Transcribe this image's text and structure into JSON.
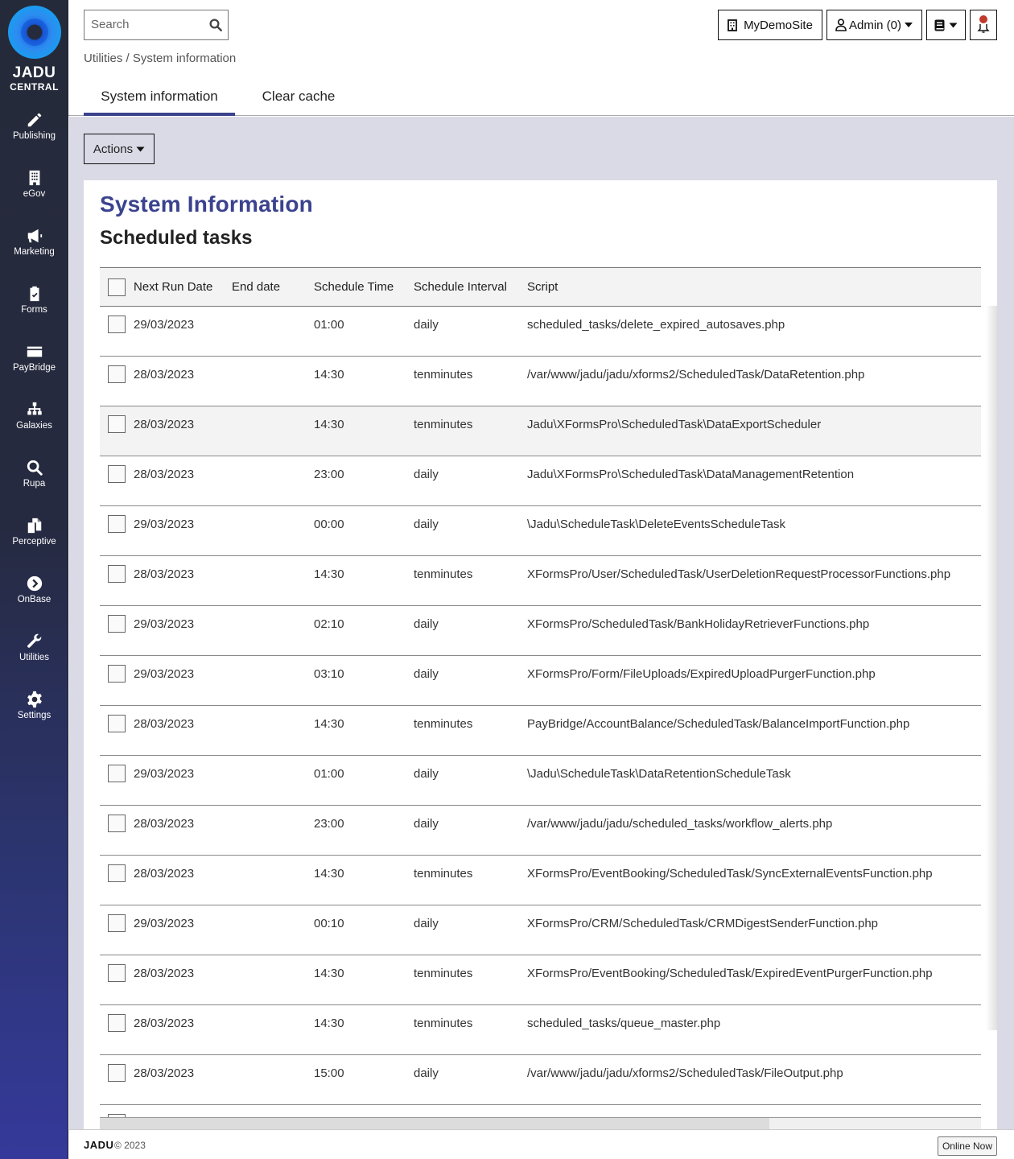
{
  "brand": {
    "name_line1": "JADU",
    "name_line2": "CENTRAL",
    "accent_color": "#3b428e"
  },
  "sidebar": {
    "items": [
      {
        "label": "Publishing",
        "icon": "pencil-icon"
      },
      {
        "label": "eGov",
        "icon": "building-icon"
      },
      {
        "label": "Marketing",
        "icon": "megaphone-icon"
      },
      {
        "label": "Forms",
        "icon": "clipboard-check-icon"
      },
      {
        "label": "PayBridge",
        "icon": "credit-card-icon"
      },
      {
        "label": "Galaxies",
        "icon": "sitemap-icon"
      },
      {
        "label": "Rupa",
        "icon": "search-icon"
      },
      {
        "label": "Perceptive",
        "icon": "copy-icon"
      },
      {
        "label": "OnBase",
        "icon": "chevron-circle-right-icon"
      },
      {
        "label": "Utilities",
        "icon": "wrench-icon"
      },
      {
        "label": "Settings",
        "icon": "gear-icon"
      }
    ]
  },
  "header": {
    "search_placeholder": "Search",
    "site_button": "MyDemoSite",
    "user_button": "Admin (0)",
    "breadcrumb": [
      "Utilities",
      "System information"
    ],
    "breadcrumb_separator": " / "
  },
  "tabs": [
    {
      "label": "System information",
      "active": true
    },
    {
      "label": "Clear cache",
      "active": false
    }
  ],
  "toolbar": {
    "actions_label": "Actions"
  },
  "panel": {
    "title": "System Information",
    "subtitle": "Scheduled tasks"
  },
  "table": {
    "columns": [
      "Next Run Date",
      "End date",
      "Schedule Time",
      "Schedule Interval",
      "Script"
    ],
    "rows": [
      {
        "next_run": "29/03/2023",
        "end_date": "",
        "time": "01:00",
        "interval": "daily",
        "script": "scheduled_tasks/delete_expired_autosaves.php"
      },
      {
        "next_run": "28/03/2023",
        "end_date": "",
        "time": "14:30",
        "interval": "tenminutes",
        "script": "/var/www/jadu/jadu/xforms2/ScheduledTask/DataRetention.php"
      },
      {
        "next_run": "28/03/2023",
        "end_date": "",
        "time": "14:30",
        "interval": "tenminutes",
        "script": "Jadu\\XFormsPro\\ScheduledTask\\DataExportScheduler",
        "highlighted": true
      },
      {
        "next_run": "28/03/2023",
        "end_date": "",
        "time": "23:00",
        "interval": "daily",
        "script": "Jadu\\XFormsPro\\ScheduledTask\\DataManagementRetention"
      },
      {
        "next_run": "29/03/2023",
        "end_date": "",
        "time": "00:00",
        "interval": "daily",
        "script": "\\Jadu\\ScheduleTask\\DeleteEventsScheduleTask"
      },
      {
        "next_run": "28/03/2023",
        "end_date": "",
        "time": "14:30",
        "interval": "tenminutes",
        "script": "XFormsPro/User/ScheduledTask/UserDeletionRequestProcessorFunctions.php"
      },
      {
        "next_run": "29/03/2023",
        "end_date": "",
        "time": "02:10",
        "interval": "daily",
        "script": "XFormsPro/ScheduledTask/BankHolidayRetrieverFunctions.php"
      },
      {
        "next_run": "29/03/2023",
        "end_date": "",
        "time": "03:10",
        "interval": "daily",
        "script": "XFormsPro/Form/FileUploads/ExpiredUploadPurgerFunction.php"
      },
      {
        "next_run": "28/03/2023",
        "end_date": "",
        "time": "14:30",
        "interval": "tenminutes",
        "script": "PayBridge/AccountBalance/ScheduledTask/BalanceImportFunction.php"
      },
      {
        "next_run": "29/03/2023",
        "end_date": "",
        "time": "01:00",
        "interval": "daily",
        "script": "\\Jadu\\ScheduleTask\\DataRetentionScheduleTask"
      },
      {
        "next_run": "28/03/2023",
        "end_date": "",
        "time": "23:00",
        "interval": "daily",
        "script": "/var/www/jadu/jadu/scheduled_tasks/workflow_alerts.php"
      },
      {
        "next_run": "28/03/2023",
        "end_date": "",
        "time": "14:30",
        "interval": "tenminutes",
        "script": "XFormsPro/EventBooking/ScheduledTask/SyncExternalEventsFunction.php"
      },
      {
        "next_run": "29/03/2023",
        "end_date": "",
        "time": "00:10",
        "interval": "daily",
        "script": "XFormsPro/CRM/ScheduledTask/CRMDigestSenderFunction.php"
      },
      {
        "next_run": "28/03/2023",
        "end_date": "",
        "time": "14:30",
        "interval": "tenminutes",
        "script": "XFormsPro/EventBooking/ScheduledTask/ExpiredEventPurgerFunction.php"
      },
      {
        "next_run": "28/03/2023",
        "end_date": "",
        "time": "14:30",
        "interval": "tenminutes",
        "script": "scheduled_tasks/queue_master.php"
      },
      {
        "next_run": "28/03/2023",
        "end_date": "",
        "time": "15:00",
        "interval": "daily",
        "script": "/var/www/jadu/jadu/xforms2/ScheduledTask/FileOutput.php"
      },
      {
        "next_run": "",
        "end_date": "",
        "time": "",
        "interval": "",
        "script": ""
      }
    ],
    "horizontal_scroll_visible_fraction": 0.76
  },
  "footer": {
    "brand": "JADU",
    "copyright": "© 2023",
    "online_button": "Online Now"
  }
}
